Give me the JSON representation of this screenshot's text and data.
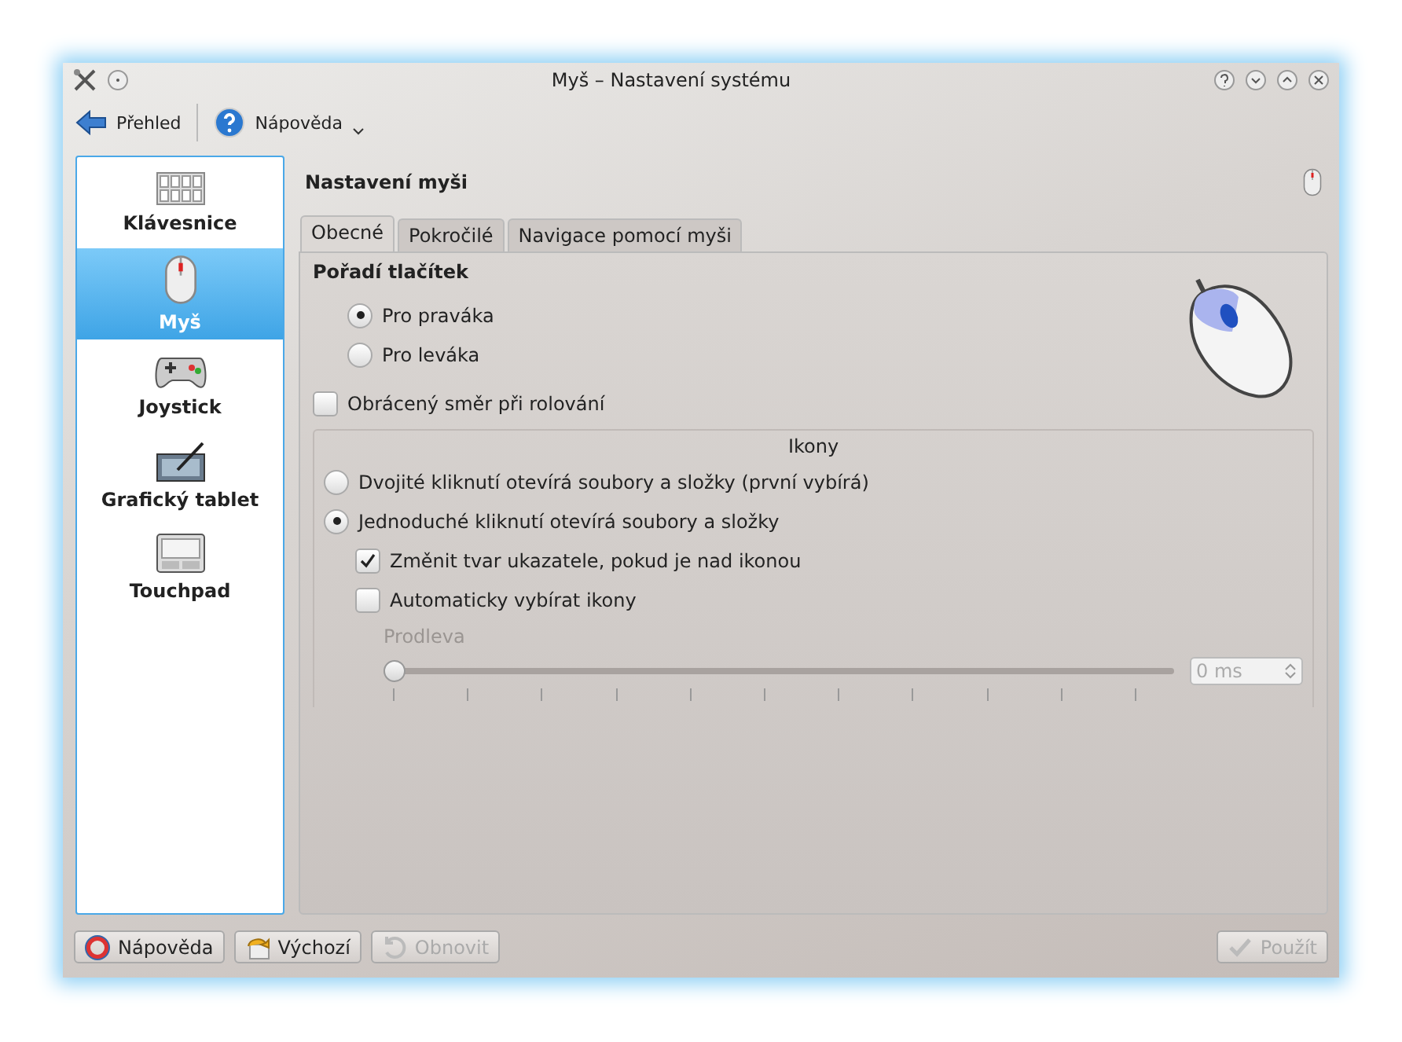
{
  "window": {
    "title": "Myš – Nastavení systému"
  },
  "toolbar": [
    {
      "label": "Přehled",
      "kind": "back"
    },
    {
      "label": "Nápověda",
      "kind": "help",
      "dropdown": true
    }
  ],
  "sidebar": {
    "items": [
      {
        "label": "Klávesnice",
        "kind": "keyboard",
        "selected": false
      },
      {
        "label": "Myš",
        "kind": "mouse",
        "selected": true
      },
      {
        "label": "Joystick",
        "kind": "gamepad",
        "selected": false
      },
      {
        "label": "Grafický tablet",
        "kind": "tablet",
        "selected": false
      },
      {
        "label": "Touchpad",
        "kind": "touchpad",
        "selected": false
      }
    ]
  },
  "header": "Nastavení myši",
  "tabs": [
    {
      "label": "Obecné",
      "selected": true
    },
    {
      "label": "Pokročilé",
      "selected": false
    },
    {
      "label": "Navigace pomocí myši",
      "selected": false
    }
  ],
  "button_order": {
    "title": "Pořadí tlačítek",
    "options": [
      {
        "label": "Pro praváka",
        "selected": true
      },
      {
        "label": "Pro leváka",
        "selected": false
      }
    ]
  },
  "reverse_scroll": {
    "label": "Obrácený směr při rolování",
    "checked": false
  },
  "icons": {
    "title": "Ikony",
    "options": [
      {
        "label": "Dvojité kliknutí otevírá soubory a složky (první vybírá)",
        "selected": false
      },
      {
        "label": "Jednoduché kliknutí otevírá soubory a složky",
        "selected": true
      }
    ],
    "checks": [
      {
        "label": "Změnit tvar ukazatele, pokud je nad ikonou",
        "checked": true
      },
      {
        "label": "Automaticky vybírat ikony",
        "checked": false
      }
    ],
    "delay": {
      "label": "Prodleva",
      "disabled": true,
      "level": 0,
      "value": "0 ms"
    }
  },
  "buttons": [
    {
      "label": "Nápověda",
      "kind": "help",
      "disabled": false
    },
    {
      "label": "Výchozí",
      "kind": "defaults",
      "disabled": false
    },
    {
      "label": "Obnovit",
      "kind": "reset",
      "disabled": true
    },
    {
      "label": "Použít",
      "kind": "apply",
      "disabled": true
    }
  ]
}
